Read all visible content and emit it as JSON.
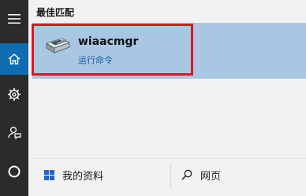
{
  "left_rail": {
    "items": [
      {
        "icon": "hamburger-menu-icon"
      },
      {
        "icon": "home-icon",
        "active": true
      },
      {
        "icon": "gear-icon"
      },
      {
        "icon": "feedback-icon"
      },
      {
        "icon": "cortana-circle-icon"
      }
    ],
    "rail_color": "#2b2b2b",
    "active_color": "#0f6cb0"
  },
  "results": {
    "section_title": "最佳匹配",
    "best_match": {
      "name": "wiaacmgr",
      "type": "运行命令",
      "icon": "command-scanner-icon",
      "highlight_color": "#a9c7e3",
      "annotation_color": "#e0141e"
    }
  },
  "bottom_bar": {
    "my_stuff_label": "我的资料",
    "my_stuff_icon": "windows-logo-icon",
    "web_label": "网页",
    "web_icon": "search-icon"
  }
}
